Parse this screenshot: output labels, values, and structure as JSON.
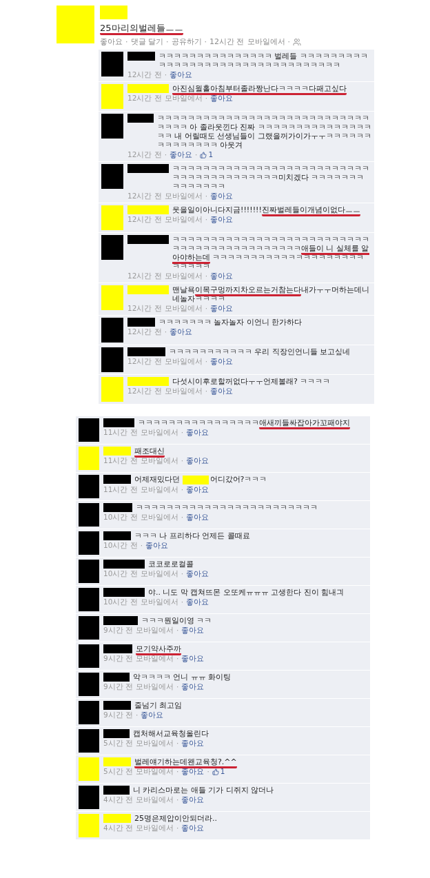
{
  "separator": "·",
  "post": {
    "color": "#ffff00",
    "segments": [
      {
        "kind": "text",
        "text": "25마리의벌레들ㅡㅡ",
        "marked": true
      }
    ],
    "actions": [
      "좋아요",
      "댓글 달기",
      "공유하기"
    ],
    "time": "12시간 전",
    "via": "모바일에서",
    "replies": [
      {
        "color": "#000000",
        "segments": [
          {
            "kind": "text",
            "text": "ㅋㅋㅋㅋㅋㅋㅋㅋㅋㅋㅋㅋㅋㅋㅋ 벌레들 ㅋㅋㅋㅋㅋㅋㅋㅋㅋㅋㅋㅋㅋㅋㅋㅋㅋㅋㅋㅋㅋㅋㅋㅋㅋㅋㅋㅋㅋㅋㅋㅋㅋ",
            "marked": false
          }
        ],
        "time": "12시간 전",
        "like": "좋아요"
      },
      {
        "color": "#ffff00",
        "segments": [
          {
            "kind": "text",
            "text": "아진심월홀아침부터졸라짱난다ㅋㅋㅋㅋ다패고싶다",
            "marked": true
          }
        ],
        "time": "12시간 전",
        "via": "모바일에서",
        "like": "좋아요"
      },
      {
        "color": "#000000",
        "segments": [
          {
            "kind": "text",
            "text": "ㅋㅋㅋㅋㅋㅋㅋㅋㅋㅋㅋㅋㅋㅋㅋㅋㅋㅋㅋㅋㅋㅋㅋㅋㅋㅋㅋㅋㅋㅋㅋㅋ 아 졸라웃낀다 진짜 ㅋㅋㅋㅋㅋㅋㅋㅋㅋㅋㅋㅋㅋㅋㅋㅋㅋ 내 어릴때도 선생님들이 그랬을꺼가이가ㅜㅜㅋㅋㅋㅋㅋㅋㅋㅋㅋㅋㅋㅋㅋㅋ 아웃겨",
            "marked": false
          }
        ],
        "time": "12시간 전",
        "like": "좋아요",
        "likes": "1"
      },
      {
        "color": "#000000",
        "segments": [
          {
            "kind": "text",
            "text": "ㅋㅋㅋㅋㅋㅋㅋㅋㅋㅋㅋㅋㅋㅋㅋㅋㅋㅋㅋㅋㅋㅋㅋㅋㅋㅋㅋㅋㅋㅋㅋㅋㅋㅋㅋㅋㅋㅋㅋㅋ미치겠다 ㅋㅋㅋㅋㅋㅋㅋㅋㅋㅋㅋㅋㅋㅋ",
            "marked": false
          }
        ],
        "time": "12시간 전",
        "via": "모바일에서",
        "like": "좋아요"
      },
      {
        "color": "#ffff00",
        "segments": [
          {
            "kind": "text",
            "text": "웃을일이아니다지금!!!!!!!",
            "marked": false
          },
          {
            "kind": "text",
            "text": "진짜벌레들이개념이없다ㅡㅡ",
            "marked": true
          }
        ],
        "time": "12시간 전",
        "via": "모바일에서",
        "like": "좋아요"
      },
      {
        "color": "#000000",
        "segments": [
          {
            "kind": "text",
            "text": "ㅋㅋㅋㅋㅋㅋㅋㅋㅋㅋㅋㅋㅋㅋㅋㅋㅋㅋㅋㅋㅋㅋㅋㅋㅋㅋㅋㅋㅋㅋㅋㅋㅋㅋㅋㅋㅋㅋㅋㅋㅋㅋㅋ",
            "marked": false
          },
          {
            "kind": "text",
            "text": "애들이 니 실체를 알아야하는데",
            "marked": true
          },
          {
            "kind": "text",
            "text": " ㅋㅋㅋㅋㅋㅋㅋㅋㅋㅋㅋㅋㅋㅋㅋㅋㅋㅋㅋㅋㅋㅋㅋㅋㅋ",
            "marked": false
          }
        ],
        "time": "12시간 전",
        "via": "모바일에서",
        "like": "좋아요"
      },
      {
        "color": "#ffff00",
        "segments": [
          {
            "kind": "text",
            "text": "맨날욕",
            "marked": false
          },
          {
            "kind": "text",
            "text": "이목구멍까지차오르는거참는다",
            "marked": true
          },
          {
            "kind": "text",
            "text": "내가ㅜㅜ머하는데니네놀자ㅋㅋㅋㅋ",
            "marked": false
          }
        ],
        "time": "12시간 전",
        "via": "모바일에서",
        "like": "좋아요"
      },
      {
        "color": "#000000",
        "segments": [
          {
            "kind": "text",
            "text": "ㅋㅋㅋㅋㅋㅋㅋ 놀자놀자 이언니 한가하다",
            "marked": false
          }
        ],
        "time": "12시간 전",
        "like": "좋아요"
      },
      {
        "color": "#000000",
        "segments": [
          {
            "kind": "text",
            "text": "ㅋㅋㅋㅋㅋㅋㅋㅋㅋㅋㅋ 우리 직장인언니들 보고싶네",
            "marked": false
          }
        ],
        "time": "12시간 전",
        "via": "모바일에서",
        "like": "좋아요"
      },
      {
        "color": "#ffff00",
        "segments": [
          {
            "kind": "text",
            "text": "다섯시이후로할꺼없다ㅜㅜ언제볼래? ㅋㅋㅋㅋ",
            "marked": false
          }
        ],
        "time": "12시간 전",
        "via": "모바일에서",
        "like": "좋아요"
      }
    ]
  },
  "more_comments": [
    {
      "color": "#000000",
      "segments": [
        {
          "kind": "text",
          "text": "ㅋㅋㅋㅋㅋㅋㅋㅋㅋㅋㅋㅋㅋㅋㅋㅋ",
          "marked": false
        },
        {
          "kind": "text",
          "text": "애새끼들싸잡아가꼬패야지",
          "marked": true
        }
      ],
      "time": "11시간 전",
      "via": "모바일에서",
      "like": "좋아요"
    },
    {
      "color": "#ffff00",
      "segments": [
        {
          "kind": "text",
          "text": "패조대신",
          "marked": true
        }
      ],
      "time": "11시간 전",
      "via": "모바일에서",
      "like": "좋아요"
    },
    {
      "color": "#000000",
      "segments": [
        {
          "kind": "text",
          "text": "어제재밌다던 ",
          "marked": false
        },
        {
          "kind": "redaction",
          "color": "#ffff00"
        },
        {
          "kind": "text",
          "text": "어디갔어?ㅋㅋㅋ",
          "marked": false
        }
      ],
      "time": "11시간 전",
      "via": "모바일에서",
      "like": "좋아요"
    },
    {
      "color": "#000000",
      "segments": [
        {
          "kind": "text",
          "text": "ㅋㅋㅋㅋㅋㅋㅋㅋㅋㅋㅋㅋㅋㅋㅋㅋㅋㅋㅋㅋㅋㅋㅋㅋ",
          "marked": false
        }
      ],
      "time": "10시간 전",
      "via": "모바일에서",
      "like": "좋아요"
    },
    {
      "color": "#000000",
      "segments": [
        {
          "kind": "text",
          "text": "ㅋㅋㅋ 나 프리하다 언제든 콜때료",
          "marked": false
        }
      ],
      "time": "10시간 전",
      "like": "좋아요"
    },
    {
      "color": "#000000",
      "segments": [
        {
          "kind": "text",
          "text": "코코로로컬콜",
          "marked": false
        }
      ],
      "time": "10시간 전",
      "via": "모바일에서",
      "like": "좋아요"
    },
    {
      "color": "#000000",
      "segments": [
        {
          "kind": "text",
          "text": "야.. 니도 막 캡쳐뜨몬 오또케ㅠㅠㅠ 고생한다 진이 힘내긔",
          "marked": false
        }
      ],
      "time": "10시간 전",
      "via": "모바일에서",
      "like": "좋아요"
    },
    {
      "color": "#000000",
      "segments": [
        {
          "kind": "text",
          "text": "ㅋㅋㅋ뭔일이영 ㅋㅋ",
          "marked": false
        }
      ],
      "time": "9시간 전",
      "via": "모바일에서",
      "like": "좋아요"
    },
    {
      "color": "#000000",
      "segments": [
        {
          "kind": "text",
          "text": "모기약사주까",
          "marked": true
        }
      ],
      "time": "9시간 전",
      "via": "모바일에서",
      "like": "좋아요"
    },
    {
      "color": "#000000",
      "segments": [
        {
          "kind": "text",
          "text": "악ㅋㅋㅋㅋ 언니 ㅠㅠ 화이팅",
          "marked": false
        }
      ],
      "time": "9시간 전",
      "via": "모바일에서",
      "like": "좋아요"
    },
    {
      "color": "#000000",
      "segments": [
        {
          "kind": "text",
          "text": "줄넘기 최고임",
          "marked": false
        }
      ],
      "time": "9시간 전",
      "like": "좋아요"
    },
    {
      "color": "#000000",
      "segments": [
        {
          "kind": "text",
          "text": "캡처해서교육청올린다",
          "marked": false
        }
      ],
      "time": "5시간 전",
      "via": "모바일에서",
      "like": "좋아요"
    },
    {
      "color": "#ffff00",
      "segments": [
        {
          "kind": "text",
          "text": "벌레얘기하는데왠교육청?.^^",
          "marked": true
        }
      ],
      "time": "5시간 전",
      "via": "모바일에서",
      "like": "좋아요",
      "likes": "1"
    },
    {
      "color": "#000000",
      "segments": [
        {
          "kind": "text",
          "text": "니 카리스마로는 애들 기가 디쥐지 않더나",
          "marked": false
        }
      ],
      "time": "4시간 전",
      "via": "모바일에서",
      "like": "좋아요"
    },
    {
      "color": "#ffff00",
      "segments": [
        {
          "kind": "text",
          "text": "25명은제압이안되더라..",
          "marked": false
        }
      ],
      "time": "4시간 전",
      "via": "모바일에서",
      "like": "좋아요"
    }
  ]
}
